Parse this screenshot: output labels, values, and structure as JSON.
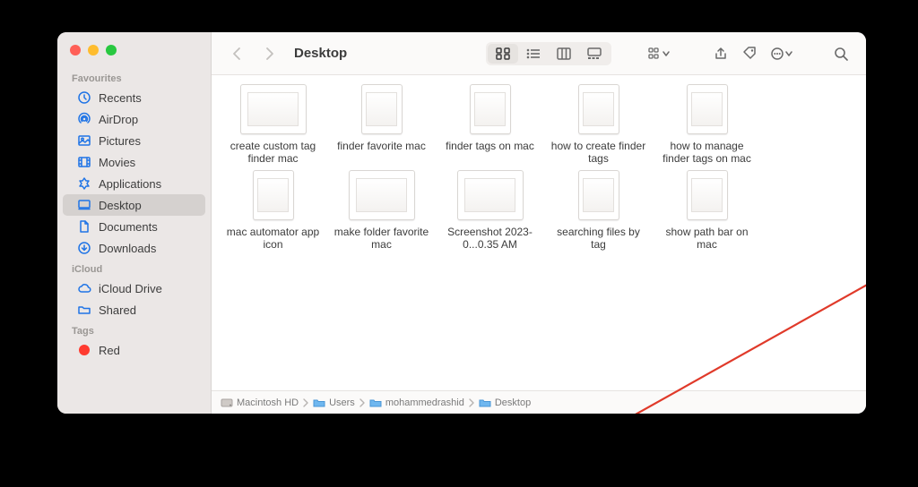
{
  "window": {
    "title": "Desktop"
  },
  "sidebar": {
    "sections": [
      {
        "label": "Favourites",
        "items": [
          {
            "icon": "clock",
            "label": "Recents"
          },
          {
            "icon": "airdrop",
            "label": "AirDrop"
          },
          {
            "icon": "photo",
            "label": "Pictures"
          },
          {
            "icon": "film",
            "label": "Movies"
          },
          {
            "icon": "app",
            "label": "Applications"
          },
          {
            "icon": "desktop",
            "label": "Desktop",
            "selected": true
          },
          {
            "icon": "doc",
            "label": "Documents"
          },
          {
            "icon": "down",
            "label": "Downloads"
          }
        ]
      },
      {
        "label": "iCloud",
        "items": [
          {
            "icon": "cloud",
            "label": "iCloud Drive"
          },
          {
            "icon": "folder",
            "label": "Shared"
          }
        ]
      },
      {
        "label": "Tags",
        "items": [
          {
            "icon": "tagdot-red",
            "label": "Red"
          }
        ]
      }
    ]
  },
  "files": [
    {
      "name": "create custom tag finder mac",
      "thumb": "wide"
    },
    {
      "name": "finder favorite mac",
      "thumb": "narrow"
    },
    {
      "name": "finder tags on mac",
      "thumb": "narrow"
    },
    {
      "name": "how to create finder tags",
      "thumb": "narrow"
    },
    {
      "name": "how to manage finder tags on mac",
      "thumb": "narrow"
    },
    {
      "name": "mac automator app icon",
      "thumb": "narrow"
    },
    {
      "name": "make folder favorite mac",
      "thumb": "wide"
    },
    {
      "name": "Screenshot 2023-0...0.35 AM",
      "thumb": "wide"
    },
    {
      "name": "searching files by tag",
      "thumb": "narrow"
    },
    {
      "name": "show path bar on mac",
      "thumb": "narrow"
    }
  ],
  "pathbar": [
    {
      "icon": "hdd",
      "label": "Macintosh HD"
    },
    {
      "icon": "folder",
      "label": "Users"
    },
    {
      "icon": "folder",
      "label": "mohammedrashid"
    },
    {
      "icon": "folder",
      "label": "Desktop"
    }
  ],
  "toolbar": {
    "view_selected": "icons"
  }
}
